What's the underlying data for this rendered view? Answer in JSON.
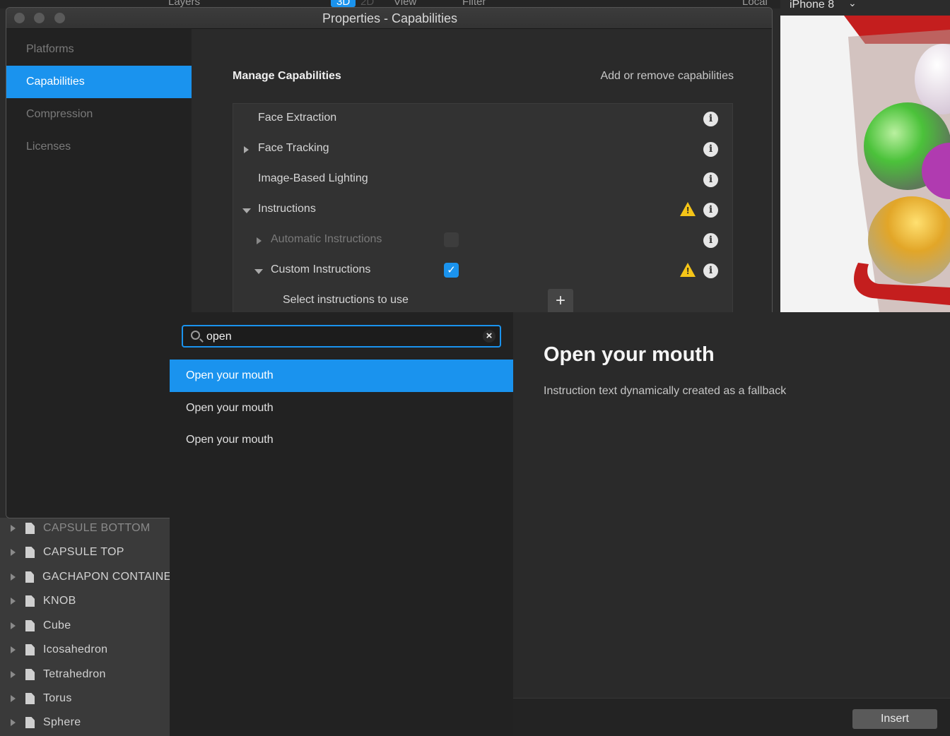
{
  "toolbar": {
    "layers_label": "Layers",
    "mode_3d": "3D",
    "mode_2d": "2D",
    "view_label": "View",
    "filter_label": "Filter",
    "local_label": "Local",
    "device_label": "iPhone 8"
  },
  "window": {
    "title": "Properties - Capabilities"
  },
  "nav": {
    "items": [
      {
        "label": "Platforms"
      },
      {
        "label": "Capabilities"
      },
      {
        "label": "Compression"
      },
      {
        "label": "Licenses"
      }
    ],
    "selected": "Capabilities"
  },
  "capabilities": {
    "title": "Manage Capabilities",
    "subtitle": "Add or remove capabilities",
    "rows": [
      {
        "label": "Face Extraction"
      },
      {
        "label": "Face Tracking"
      },
      {
        "label": "Image-Based Lighting"
      },
      {
        "label": "Instructions"
      },
      {
        "label": "Automatic Instructions",
        "checked": false
      },
      {
        "label": "Custom Instructions",
        "checked": true
      },
      {
        "label": "Select instructions to use"
      }
    ]
  },
  "scene": {
    "items": [
      {
        "label": "CAPSULE BOTTOM"
      },
      {
        "label": "CAPSULE TOP"
      },
      {
        "label": "GACHAPON CONTAINER"
      },
      {
        "label": "KNOB"
      },
      {
        "label": "Cube"
      },
      {
        "label": "Icosahedron"
      },
      {
        "label": "Tetrahedron"
      },
      {
        "label": "Torus"
      },
      {
        "label": "Sphere"
      }
    ]
  },
  "picker": {
    "search_value": "open",
    "results": [
      {
        "label": "Open your mouth"
      },
      {
        "label": "Open your mouth"
      },
      {
        "label": "Open your mouth"
      }
    ],
    "detail_title": "Open your mouth",
    "detail_description": "Instruction text dynamically created as a fallback",
    "insert_label": "Insert"
  },
  "colors": {
    "accent": "#1a93ee",
    "warning": "#f5c518"
  }
}
